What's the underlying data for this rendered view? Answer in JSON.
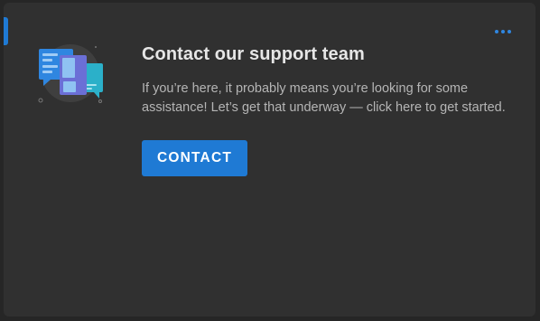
{
  "card": {
    "title": "Contact our support team",
    "description": "If you’re here, it probably means you’re looking for some assistance! Let’s get that underway — click here to get started.",
    "button_label": "CONTACT",
    "illustration_icon": "chat-bubbles-icon",
    "menu_icon": "more-horizontal-icon"
  },
  "colors": {
    "background": "#262626",
    "card": "#303030",
    "accent": "#1f7ad4",
    "title": "#e6e6e6",
    "text": "#b5b5b5"
  }
}
